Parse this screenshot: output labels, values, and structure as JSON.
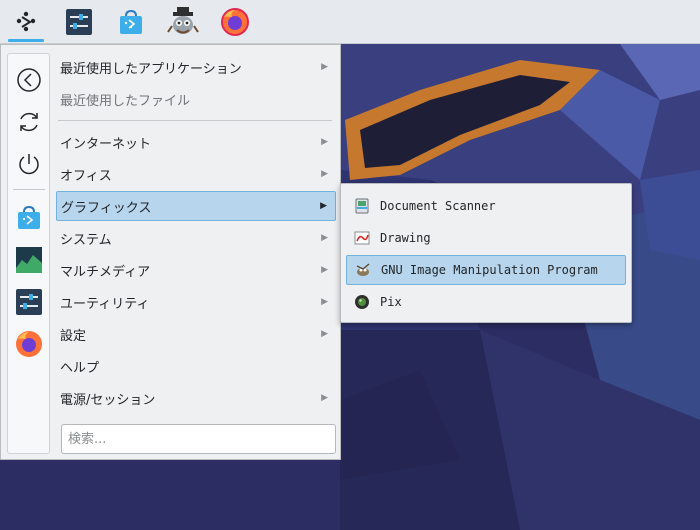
{
  "panel": {
    "tasks": [
      "application-launcher-icon",
      "system-settings-icon",
      "discover-store-icon",
      "konqi-user-icon",
      "firefox-icon"
    ]
  },
  "favorites": [
    "back-icon",
    "switch-user-icon",
    "power-icon",
    "discover-icon",
    "system-monitor-icon",
    "system-settings-icon",
    "firefox-icon"
  ],
  "menu": {
    "items": [
      {
        "label": "最近使用したアプリケーション",
        "has_submenu": true
      },
      {
        "label": "最近使用したファイル",
        "has_submenu": false,
        "disabled": true
      },
      {
        "label": "インターネット",
        "has_submenu": true
      },
      {
        "label": "オフィス",
        "has_submenu": true
      },
      {
        "label": "グラフィックス",
        "has_submenu": true,
        "selected": true
      },
      {
        "label": "システム",
        "has_submenu": true
      },
      {
        "label": "マルチメディア",
        "has_submenu": true
      },
      {
        "label": "ユーティリティ",
        "has_submenu": true
      },
      {
        "label": "設定",
        "has_submenu": true
      },
      {
        "label": "ヘルプ",
        "has_submenu": false
      },
      {
        "label": "電源/セッション",
        "has_submenu": true
      }
    ],
    "arrow": "▶",
    "search_placeholder": "検索..."
  },
  "submenu": {
    "items": [
      {
        "label": "Document Scanner",
        "icon": "scanner-icon"
      },
      {
        "label": "Drawing",
        "icon": "drawing-icon"
      },
      {
        "label": "GNU Image Manipulation Program",
        "icon": "gimp-icon",
        "selected": true
      },
      {
        "label": "Pix",
        "icon": "pix-icon"
      }
    ]
  },
  "colors": {
    "accent": "#3daee9",
    "selection_bg": "#b7d6ee",
    "selection_border": "#71b2df",
    "menu_bg": "#eff0f1",
    "panel_bg": "#e6e9ee"
  }
}
